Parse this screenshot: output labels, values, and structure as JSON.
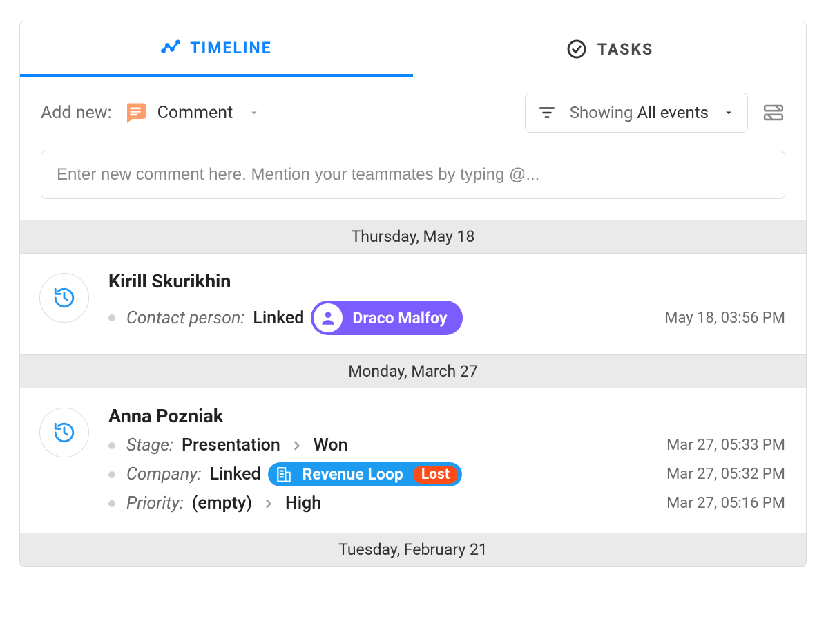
{
  "tabs": {
    "timeline": "TIMELINE",
    "tasks": "TASKS"
  },
  "toolbar": {
    "addnew_label": "Add new:",
    "comment_type": "Comment",
    "filter_prefix": "Showing ",
    "filter_value": "All events"
  },
  "comment_placeholder": "Enter new comment here. Mention your teammates by typing @...",
  "groups": [
    {
      "date": "Thursday, May 18",
      "user": "Kirill Skurikhin",
      "rows": [
        {
          "field": "Contact person:",
          "linked_word": "Linked",
          "pill_type": "purple",
          "pill_text": "Draco Malfoy",
          "timestamp": "May 18, 03:56 PM"
        }
      ]
    },
    {
      "date": "Monday, March 27",
      "user": "Anna Pozniak",
      "rows": [
        {
          "field": "Stage:",
          "from": "Presentation",
          "to": "Won",
          "timestamp": "Mar 27, 05:33 PM"
        },
        {
          "field": "Company:",
          "linked_word": "Linked",
          "pill_type": "blue",
          "pill_text": "Revenue Loop",
          "pill_badge": "Lost",
          "timestamp": "Mar 27, 05:32 PM"
        },
        {
          "field": "Priority:",
          "from": "(empty)",
          "to": "High",
          "timestamp": "Mar 27, 05:16 PM"
        }
      ]
    },
    {
      "date": "Tuesday, February 21"
    }
  ]
}
